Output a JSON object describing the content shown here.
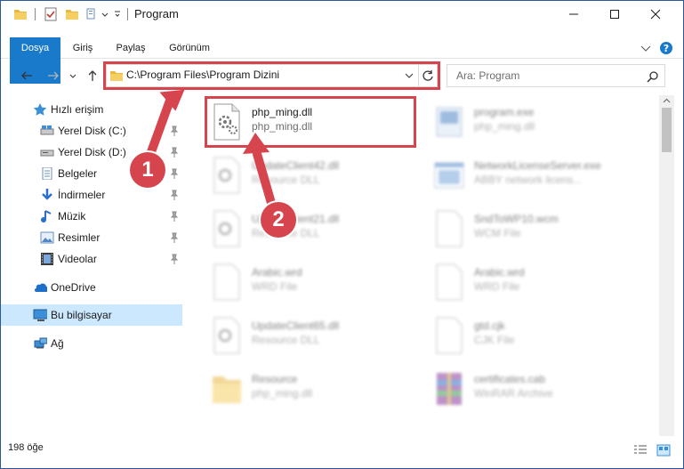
{
  "window": {
    "title": "Program"
  },
  "ribbon": {
    "tabs": [
      {
        "label": "Dosya"
      },
      {
        "label": "Giriş"
      },
      {
        "label": "Paylaş"
      },
      {
        "label": "Görünüm"
      }
    ]
  },
  "address": {
    "path": "C:\\Program Files\\Program Dizini"
  },
  "search": {
    "placeholder": "Ara: Program"
  },
  "nav": {
    "quick_access": "Hızlı erişim",
    "items": [
      {
        "label": "Yerel Disk (C:)"
      },
      {
        "label": "Yerel Disk (D:)"
      },
      {
        "label": "Belgeler"
      },
      {
        "label": "İndirmeler"
      },
      {
        "label": "Müzik"
      },
      {
        "label": "Resimler"
      },
      {
        "label": "Videolar"
      }
    ],
    "onedrive": "OneDrive",
    "this_pc": "Bu bilgisayar",
    "network": "Ağ"
  },
  "files": [
    {
      "name": "php_ming.dll",
      "type": "php_ming.dll"
    },
    {
      "name": "program.exe",
      "type": "php_ming.dll"
    },
    {
      "name": "UpdateClient42.dll",
      "type": "Resource DLL"
    },
    {
      "name": "NetworkLicenseServer.exe",
      "type": "ABBY network licens..."
    },
    {
      "name": "UpdateClient21.dll",
      "type": "Resource DLL"
    },
    {
      "name": "SndToWP10.wcm",
      "type": "WCM File"
    },
    {
      "name": "Arabic.wrd",
      "type": "WRD File"
    },
    {
      "name": "Arabic.wrd",
      "type": "WRD File"
    },
    {
      "name": "UpdateClient65.dll",
      "type": "Resource DLL"
    },
    {
      "name": "gtd.cjk",
      "type": "CJK File"
    },
    {
      "name": "Resource",
      "type": "php_ming.dll"
    },
    {
      "name": "certificates.cab",
      "type": "WinRAR Archive"
    }
  ],
  "status": {
    "count": "198 öğe"
  },
  "annotations": {
    "step1": "1",
    "step2": "2"
  },
  "colors": {
    "accent": "#1979ca",
    "highlight": "#d6454d",
    "selected": "#cce8ff"
  }
}
